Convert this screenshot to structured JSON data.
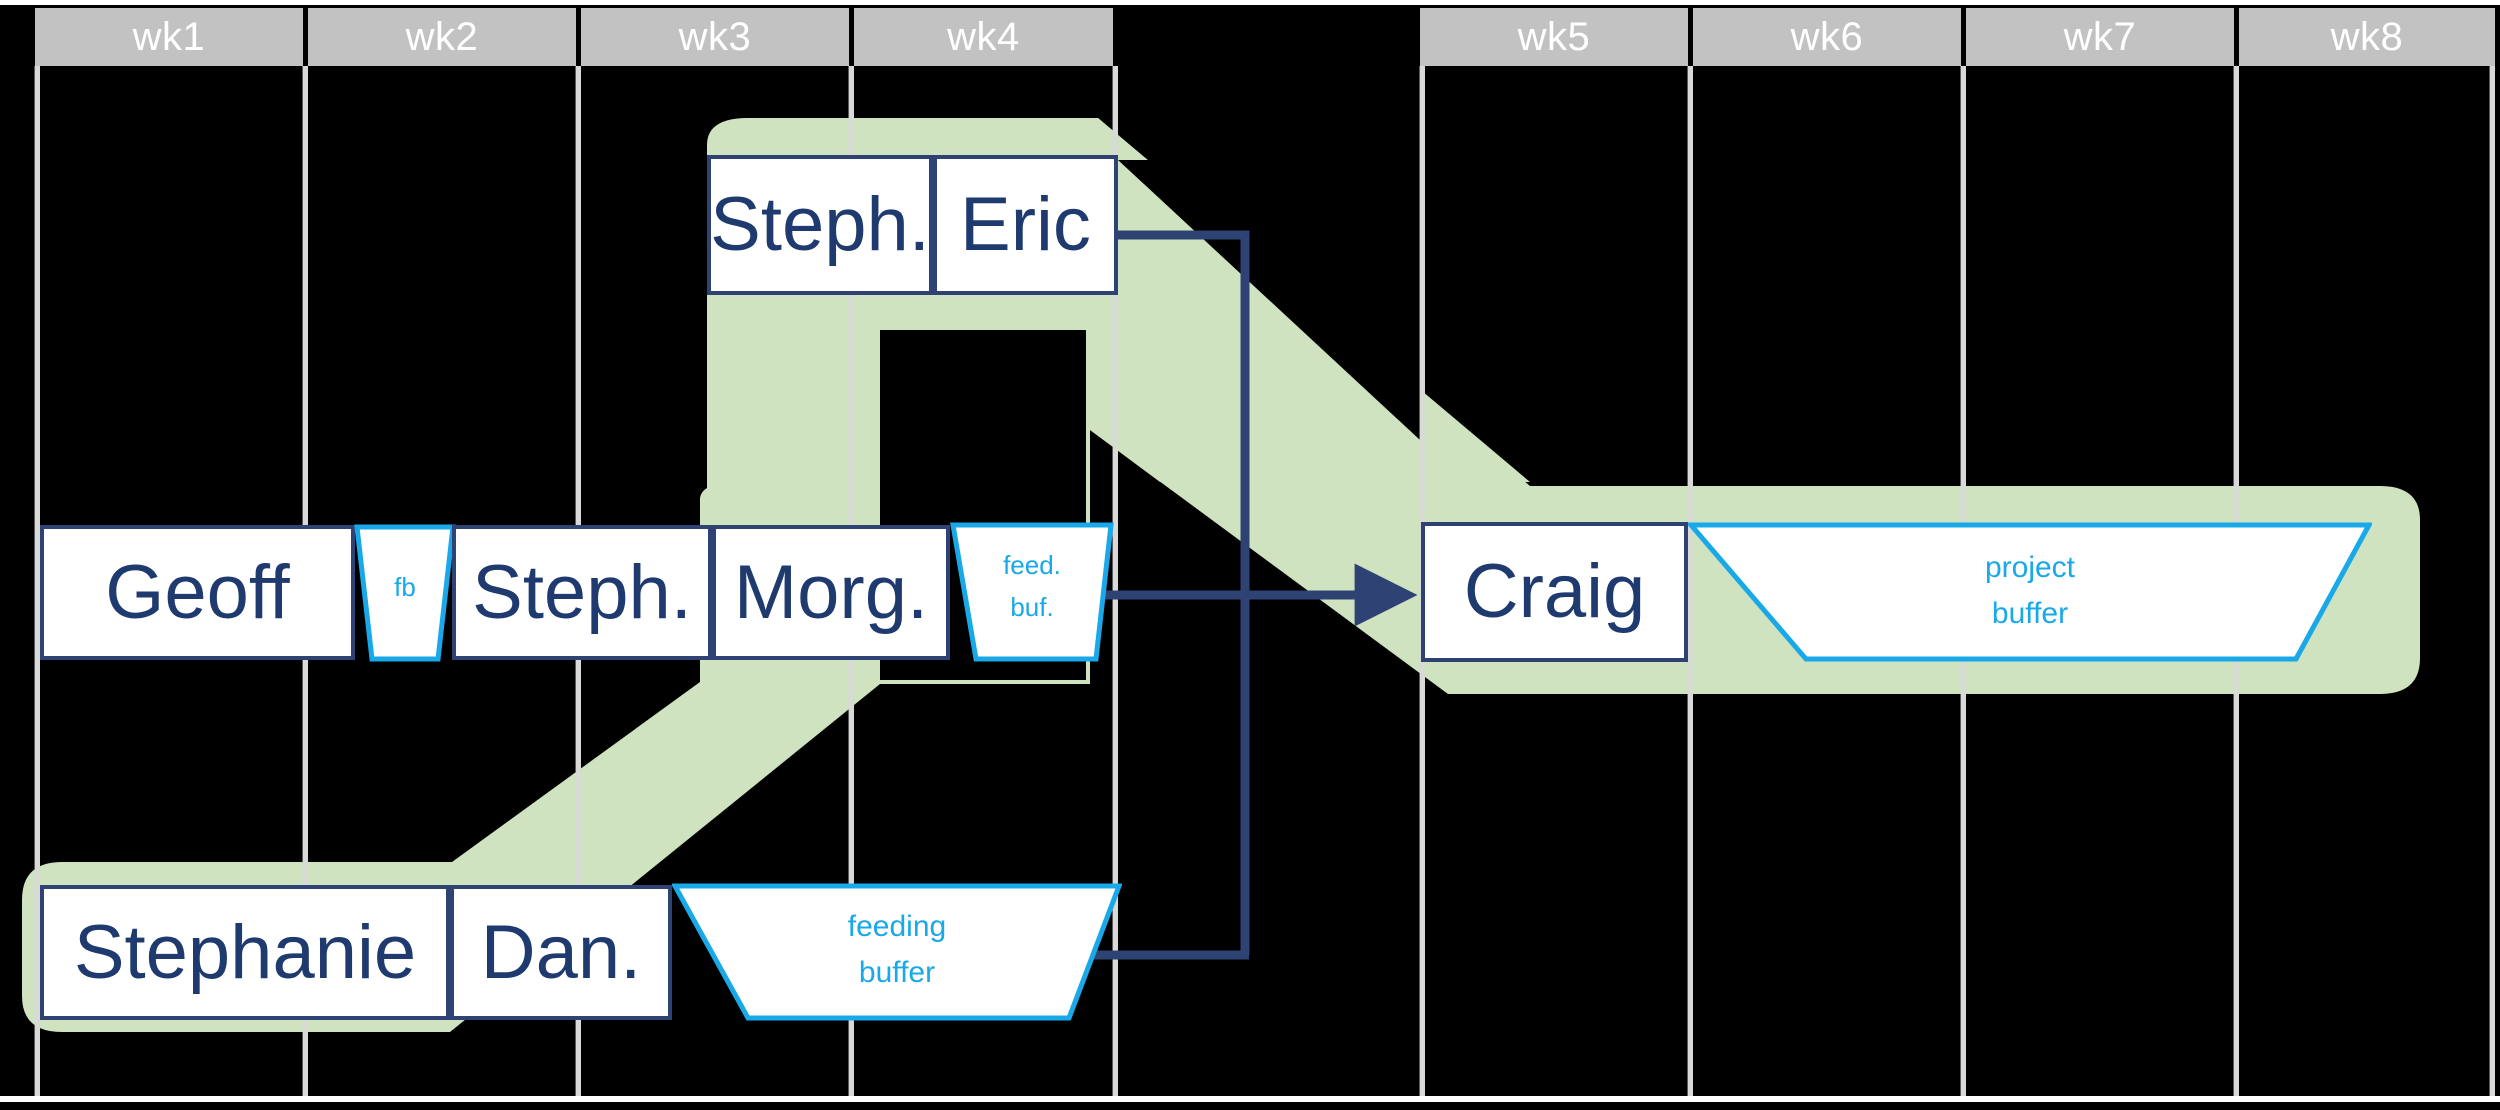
{
  "diagram": {
    "type": "critical-chain-project-gantt",
    "colors": {
      "background": "#000000",
      "header_fill": "#c2c2c2",
      "header_text": "#ffffff",
      "grid_line": "#d9d9d9",
      "task_fill": "#ffffff",
      "task_border": "#2e4374",
      "task_text": "#1f3a6e",
      "buffer_border": "#19a8e8",
      "buffer_text": "#19a8e8",
      "chain_band": "#cfe3c0",
      "connector": "#2e4374"
    },
    "timeline": {
      "columns": [
        {
          "label": "wk1"
        },
        {
          "label": "wk2"
        },
        {
          "label": "wk3"
        },
        {
          "label": "wk4"
        },
        {
          "label": "wk5"
        },
        {
          "label": "wk6"
        },
        {
          "label": "wk7"
        },
        {
          "label": "wk8"
        }
      ]
    },
    "rows": {
      "top": {
        "tasks": [
          {
            "label": "Steph."
          },
          {
            "label": "Eric"
          }
        ]
      },
      "middle": {
        "tasks": [
          {
            "label": "Geoff"
          },
          {
            "label": "Steph."
          },
          {
            "label": "Morg."
          },
          {
            "label": "Craig"
          }
        ],
        "buffers": [
          {
            "label": "fb",
            "lines": [
              "fb"
            ]
          },
          {
            "label": "feed. buf.",
            "lines": [
              "feed.",
              "buf."
            ]
          },
          {
            "label": "project buffer",
            "lines": [
              "project",
              "buffer"
            ]
          }
        ]
      },
      "bottom": {
        "tasks": [
          {
            "label": "Stephanie"
          },
          {
            "label": "Dan."
          }
        ],
        "buffers": [
          {
            "label": "feeding buffer",
            "lines": [
              "feeding",
              "buffer"
            ]
          }
        ]
      }
    },
    "labels": {
      "task_geoff": "Geoff",
      "task_steph_mid": "Steph.",
      "task_morg": "Morg.",
      "task_craig": "Craig",
      "task_steph_top": "Steph.",
      "task_eric": "Eric",
      "task_stephanie": "Stephanie",
      "task_dan": "Dan.",
      "buffer_fb": "fb",
      "buffer_feedbuf_l1": "feed.",
      "buffer_feedbuf_l2": "buf.",
      "buffer_project_l1": "project",
      "buffer_project_l2": "buffer",
      "buffer_feeding_l1": "feeding",
      "buffer_feeding_l2": "buffer",
      "wk1": "wk1",
      "wk2": "wk2",
      "wk3": "wk3",
      "wk4": "wk4",
      "wk5": "wk5",
      "wk6": "wk6",
      "wk7": "wk7",
      "wk8": "wk8"
    }
  }
}
